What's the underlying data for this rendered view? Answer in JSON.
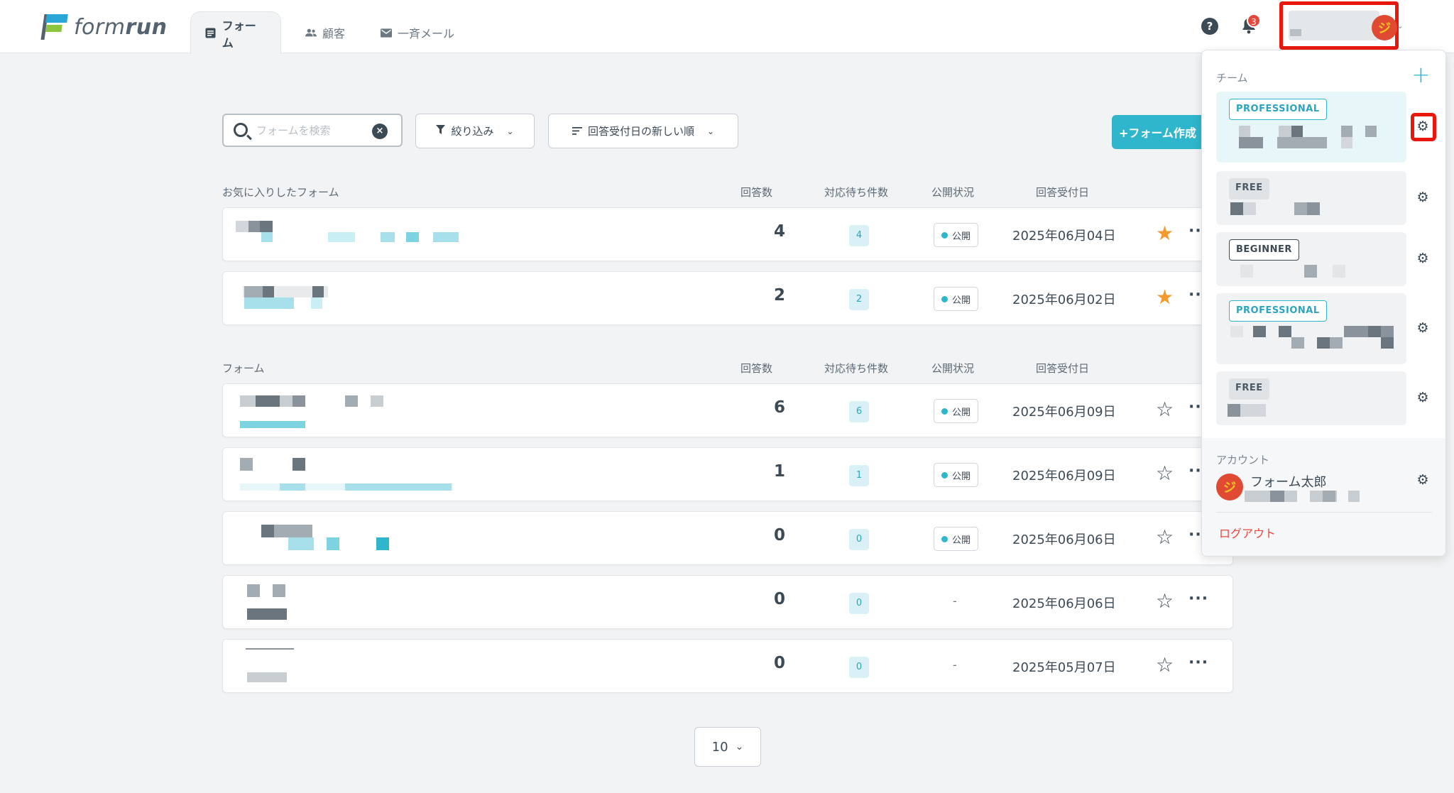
{
  "app": {
    "logo_text_light": "form",
    "logo_text_bold": "run"
  },
  "nav": {
    "tabs": [
      {
        "label": "フォーム",
        "icon": "form-icon",
        "active": true
      },
      {
        "label": "顧客",
        "icon": "users-icon",
        "active": false
      },
      {
        "label": "一斉メール",
        "icon": "mail-icon",
        "active": false
      }
    ],
    "help_glyph": "?",
    "notification_count": "3"
  },
  "toolbar": {
    "search_placeholder": "フォームを検索",
    "filter_label": "絞り込み",
    "sort_label": "回答受付日の新しい順",
    "create_label": "+フォーム作成"
  },
  "columns": {
    "responses": "回答数",
    "pending": "対応待ち件数",
    "status": "公開状況",
    "date": "回答受付日"
  },
  "favorites": {
    "title": "お気に入りしたフォーム",
    "rows": [
      {
        "responses": "4",
        "pending": "4",
        "status": "公開",
        "date": "2025年06月04日",
        "favorite": true
      },
      {
        "responses": "2",
        "pending": "2",
        "status": "公開",
        "date": "2025年06月02日",
        "favorite": true
      }
    ]
  },
  "forms": {
    "title": "フォーム",
    "rows": [
      {
        "responses": "6",
        "pending": "6",
        "status": "公開",
        "date": "2025年06月09日",
        "favorite": false
      },
      {
        "responses": "1",
        "pending": "1",
        "status": "公開",
        "date": "2025年06月09日",
        "favorite": false
      },
      {
        "responses": "0",
        "pending": "0",
        "status": "公開",
        "date": "2025年06月06日",
        "favorite": false
      },
      {
        "responses": "0",
        "pending": "0",
        "status": "-",
        "date": "2025年06月06日",
        "favorite": false
      },
      {
        "responses": "0",
        "pending": "0",
        "status": "-",
        "date": "2025年05月07日",
        "favorite": false
      }
    ]
  },
  "pagination": {
    "per_page": "10"
  },
  "account_menu": {
    "team_label": "チーム",
    "add_team_glyph": "+",
    "teams": [
      {
        "plan": "PROFESSIONAL",
        "selected": true
      },
      {
        "plan": "FREE",
        "selected": false
      },
      {
        "plan": "BEGINNER",
        "selected": false
      },
      {
        "plan": "PROFESSIONAL",
        "selected": false
      },
      {
        "plan": "FREE",
        "selected": false
      }
    ],
    "account_label": "アカウント",
    "account_name": "フォーム太郎",
    "logout_label": "ログアウト"
  },
  "colors": {
    "accent": "#2fb6cc",
    "favorite_star": "#f29a2e",
    "highlight_red": "#e8180e",
    "logout_red": "#e5483b"
  }
}
